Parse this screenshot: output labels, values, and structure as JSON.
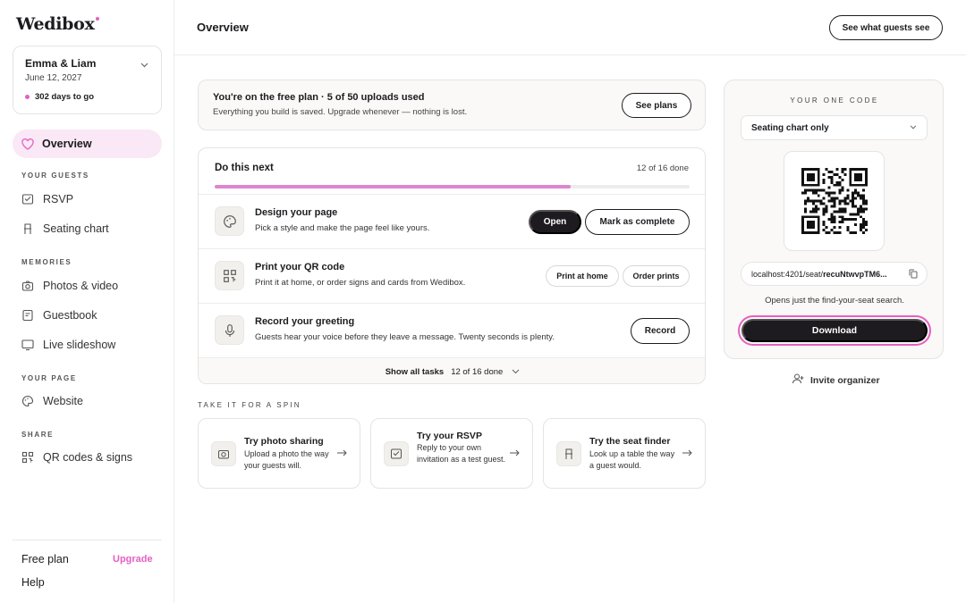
{
  "app": {
    "logo": "Wedibox"
  },
  "sidebar": {
    "couple": {
      "name": "Emma & Liam",
      "date": "June 12, 2027",
      "countdown": "302 days to go"
    },
    "active_item": "Overview",
    "sections": {
      "guests": "YOUR GUESTS",
      "memories": "MEMORIES",
      "page": "YOUR PAGE",
      "share": "SHARE"
    },
    "items": {
      "rsvp": "RSVP",
      "seating": "Seating chart",
      "photos": "Photos & video",
      "guestbook": "Guestbook",
      "slideshow": "Live slideshow",
      "website": "Website",
      "qr": "QR codes & signs"
    },
    "plan": "Free plan",
    "upgrade": "Upgrade",
    "help": "Help"
  },
  "header": {
    "title": "Overview",
    "guests_button": "See what guests see"
  },
  "plan_banner": {
    "title": "You're on the free plan · 5 of 50 uploads used",
    "subtitle": "Everything you build is saved. Upgrade whenever — nothing is lost.",
    "button": "See plans"
  },
  "tasks": {
    "title": "Do this next",
    "count": "12 of 16 done",
    "progress": 0.75,
    "items": [
      {
        "name": "Design your page",
        "desc": "Pick a style and make the page feel like yours.",
        "primary": "Open",
        "secondary": "Mark as complete"
      },
      {
        "name": "Print your QR code",
        "desc": "Print it at home, or order signs and cards from Wedibox.",
        "primary": "Print at home",
        "secondary": "Order prints"
      },
      {
        "name": "Record your greeting",
        "desc": "Guests hear your voice before they leave a message. Twenty seconds is plenty.",
        "primary": "Record"
      }
    ],
    "footer_link": "Show all tasks",
    "footer_count": "12 of 16 done"
  },
  "spin": {
    "label": "TAKE IT FOR A SPIN",
    "cards": [
      {
        "title": "Try photo sharing",
        "desc": "Upload a photo the way your guests will."
      },
      {
        "title": "Try your RSVP",
        "desc": "Reply to your own invitation as a test guest."
      },
      {
        "title": "Try the seat finder",
        "desc": "Look up a table the way a guest would."
      }
    ]
  },
  "qr_panel": {
    "label": "YOUR ONE CODE",
    "select_value": "Seating chart only",
    "url_prefix": "localhost:4201/seat/",
    "url_id": "recuNtwvpTM6...",
    "note": "Opens just the find-your-seat search.",
    "download": "Download"
  },
  "invite": "Invite organizer",
  "colors": {
    "accent": "#e65fc4",
    "active_bg": "#fae8f6",
    "dark": "#1d1b1f",
    "progress": "#de86d0"
  }
}
